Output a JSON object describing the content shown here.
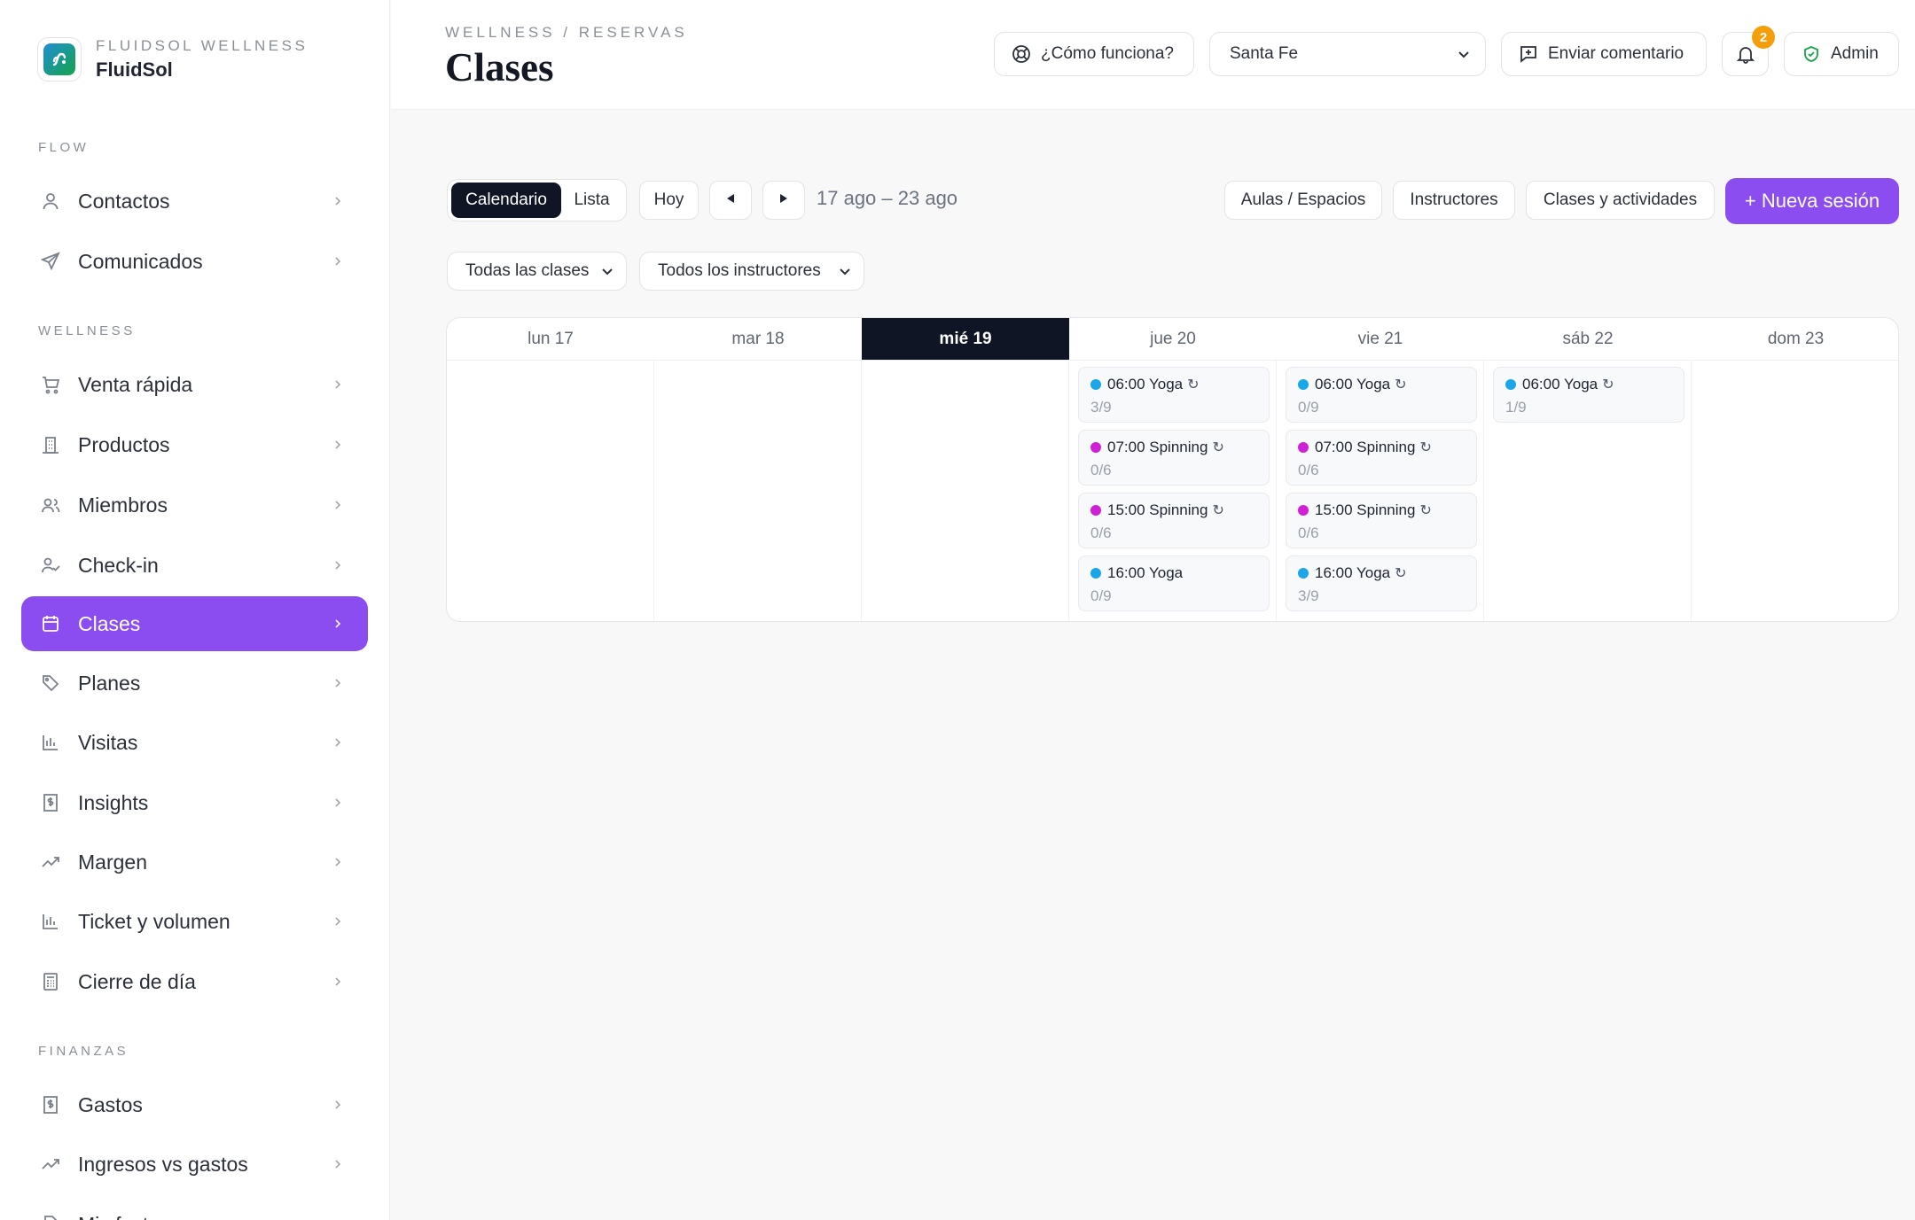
{
  "brand": {
    "org": "FLUIDSOL WELLNESS",
    "name": "FluidSol"
  },
  "sections": {
    "flow": "FLOW",
    "wellness": "WELLNESS",
    "finanzas": "FINANZAS"
  },
  "nav": {
    "contactos": "Contactos",
    "comunicados": "Comunicados",
    "venta": "Venta rápida",
    "productos": "Productos",
    "miembros": "Miembros",
    "checkin": "Check-in",
    "clases": "Clases",
    "planes": "Planes",
    "visitas": "Visitas",
    "insights": "Insights",
    "margen": "Margen",
    "ticket": "Ticket y volumen",
    "cierre": "Cierre de día",
    "gastos": "Gastos",
    "ingresos": "Ingresos vs gastos",
    "cut": "Mis facturas"
  },
  "header": {
    "breadcrumb": "WELLNESS / RESERVAS",
    "title": "Clases",
    "help": "¿Cómo funciona?",
    "location": "Santa Fe",
    "feedback": "Enviar comentario",
    "notifications": "2",
    "user": "Admin"
  },
  "toolbar": {
    "calendar": "Calendario",
    "list": "Lista",
    "today": "Hoy",
    "range": "17 ago – 23 ago",
    "spaces": "Aulas / Espacios",
    "instructors": "Instructores",
    "classes": "Clases y actividades",
    "new_session": "+ Nueva sesión",
    "filter_classes": "Todas las clases",
    "filter_instructors": "Todos los instructores"
  },
  "calendar": {
    "days": [
      "lun 17",
      "mar 18",
      "mié 19",
      "jue 20",
      "vie 21",
      "sáb 22",
      "dom 23"
    ],
    "today_index": 2,
    "events": {
      "jue": [
        {
          "label": "06:00 Yoga",
          "count": "3/9",
          "recurring": true,
          "color": "#1aa6e8"
        },
        {
          "label": "07:00 Spinning",
          "count": "0/6",
          "recurring": true,
          "color": "#d020d6"
        },
        {
          "label": "15:00 Spinning",
          "count": "0/6",
          "recurring": true,
          "color": "#d020d6"
        },
        {
          "label": "16:00 Yoga",
          "count": "0/9",
          "recurring": false,
          "color": "#1aa6e8"
        }
      ],
      "vie": [
        {
          "label": "06:00 Yoga",
          "count": "0/9",
          "recurring": true,
          "color": "#1aa6e8"
        },
        {
          "label": "07:00 Spinning",
          "count": "0/6",
          "recurring": true,
          "color": "#d020d6"
        },
        {
          "label": "15:00 Spinning",
          "count": "0/6",
          "recurring": true,
          "color": "#d020d6"
        },
        {
          "label": "16:00 Yoga",
          "count": "3/9",
          "recurring": true,
          "color": "#1aa6e8"
        }
      ],
      "sab": [
        {
          "label": "06:00 Yoga",
          "count": "1/9",
          "recurring": true,
          "color": "#1aa6e8"
        }
      ]
    },
    "recurring_glyph": "↻"
  },
  "colors": {
    "accent": "#8b4cf0",
    "dark": "#0f1524",
    "yoga": "#1aa6e8",
    "spinning": "#d020d6",
    "badge": "#f59e0b"
  }
}
